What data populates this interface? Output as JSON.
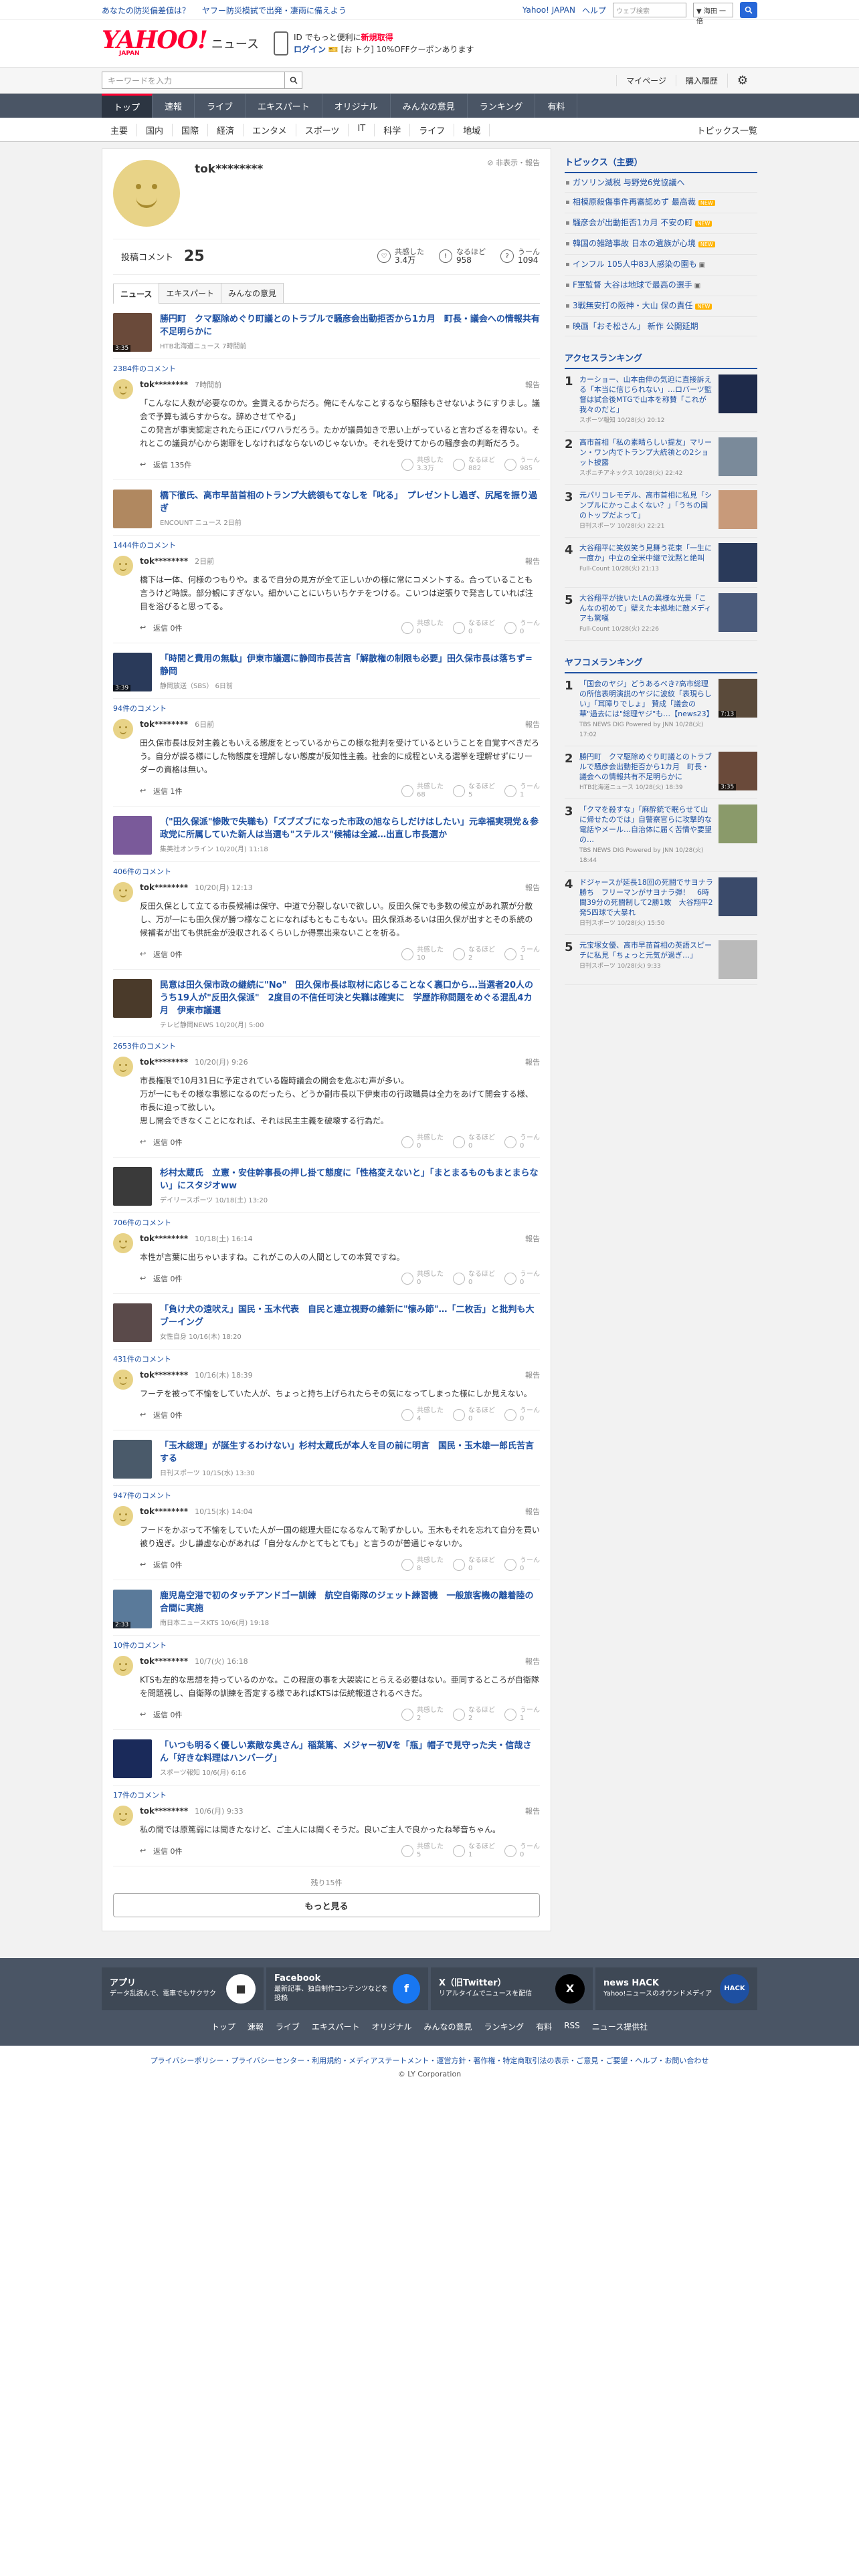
{
  "util": {
    "left1": "あなたの防災偏差値は？",
    "left2": "ヤフー防災模試で出発・凄雨に備えよう",
    "yj": "Yahoo! JAPAN",
    "help": "ヘルプ",
    "search_placeholder": "ウェブ検索",
    "search_select": "▼ 海田 一倍"
  },
  "header": {
    "logo": "YAHOO!",
    "logo_sub": "JAPAN",
    "logo_news": "ニュース",
    "promo_line1": "ID でもっと便利に",
    "promo_line1_red": "新規取得",
    "promo_login": "ログイン",
    "promo_line2": "[お トク] 10%OFFクーポンあります"
  },
  "search": {
    "placeholder": "キーワードを入力",
    "mypage": "マイページ",
    "history": "購入履歴"
  },
  "primary_nav": [
    "トップ",
    "速報",
    "ライブ",
    "エキスパート",
    "オリジナル",
    "みんなの意見",
    "ランキング",
    "有料"
  ],
  "secondary_nav": [
    "主要",
    "国内",
    "国際",
    "経済",
    "エンタメ",
    "スポーツ",
    "IT",
    "科学",
    "ライフ",
    "地域"
  ],
  "topics_list_link": "トピックス一覧",
  "profile": {
    "name": "tok********",
    "report": "非表示・報告",
    "comments_label": "投稿コメント",
    "comments_count": "25",
    "stat1_label": "共感した",
    "stat1_value": "3.4万",
    "stat2_label": "なるほど",
    "stat2_value": "958",
    "stat3_label": "うーん",
    "stat3_value": "1094",
    "tabs": [
      "ニュース",
      "エキスパート",
      "みんなの意見"
    ]
  },
  "items": [
    {
      "title": "勝円町　クマ駆除めぐり町議とのトラブルで騒彦会出動拒否から1カ月　町長・議会への情報共有不足明らかに",
      "src": "HTB北海道ニュース 7時間前",
      "dur": "3:35",
      "thumb": "#6a4a3a",
      "count": "2384件のコメント",
      "user": "tok********",
      "time": "7時間前",
      "text": "「こんなに人数が必要なのか。金貰えるからだろ。俺にそんなことするなら駆除もさせないようにすりまし。議会で予算も減らすからな。辞めさせてやる」\nこの発言が事実認定されたら正にパワハラだろう。たかが議員如きで思い上がっていると言わざるを得ない。それとこの議員が心から謝罪をしなければならないのじゃないか。それを受けてからの騒彦会の判断だろう。",
      "reply": "返信 135件",
      "r1": "共感した",
      "v1": "3.3万",
      "r2": "なるほど",
      "v2": "882",
      "r3": "うーん",
      "v3": "985"
    },
    {
      "title": "橋下徹氏、高市早苗首相のトランプ大統領もてなしを「叱る」　プレゼントし過ぎ、尻尾を振り過ぎ",
      "src": "ENCOUNT ニュース 2日前",
      "dur": "",
      "thumb": "#b08860",
      "count": "1444件のコメント",
      "user": "tok********",
      "time": "2日前",
      "text": "橋下は一体、何様のつもりや。まるで自分の見方が全て正しいかの様に常にコメントする。合っていることも言うけど時誤。部分観にすぎない。細かいことにいちいちケチをつける。こいつは逆張りで発言していれば注目を浴びると思ってる。",
      "reply": "返信 0件",
      "r1": "共感した",
      "v1": "0",
      "r2": "なるほど",
      "v2": "0",
      "r3": "うーん",
      "v3": "0"
    },
    {
      "title": "「時間と費用の無駄」伊東市議選に静岡市長苦言「解散権の制限も必要」田久保市長は落ちず=静岡",
      "src": "静岡放送（SBS） 6日前",
      "dur": "3:39",
      "thumb": "#2a3a5a",
      "count": "94件のコメント",
      "user": "tok********",
      "time": "6日前",
      "text": "田久保市長は反対主義ともいえる態度をとっているからこの様な批判を受けているということを自覚すべきだろう。自分が誤る様にした物態度を理解しない態度が反知性主義。社会的に成程といえる選挙を理解せずにリーダーの資格は無い。",
      "reply": "返信 1件",
      "r1": "共感した",
      "v1": "68",
      "r2": "なるほど",
      "v2": "5",
      "r3": "うーん",
      "v3": "1"
    },
    {
      "title": "（\"田久保派\"惨敗で失職も）「ズブズブになった市政の旭ならしだけはしたい」元幸福実現党＆参政党に所属していた新人は当選も\"ステルス\"候補は全滅…出直し市長選か",
      "src": "集英社オンライン 10/20(月) 11:18",
      "dur": "",
      "thumb": "#7a5a9a",
      "count": "406件のコメント",
      "user": "tok********",
      "time": "10/20(月) 12:13",
      "text": "反田久保として立てる市長候補は保守、中道で分裂しないで欲しい。反田久保でも多数の候立があれ票が分散し、万が一にも田久保が勝つ様なことになればもともこもない。田久保派あるいは田久保が出すとその系統の候補者が出ても供託金が没収されるくらいしか得票出来ないことを祈る。",
      "reply": "返信 0件",
      "r1": "共感した",
      "v1": "10",
      "r2": "なるほど",
      "v2": "2",
      "r3": "うーん",
      "v3": "1"
    },
    {
      "title": "民意は田久保市政の継続に\"No\"　田久保市長は取材に応じることなく裏口から…当選者20人のうち19人が\"反田久保派\"　2度目の不信任可決と失職は確実に　学歴詐称問題をめぐる混乱4カ月　伊東市議選",
      "src": "テレビ静岡NEWS 10/20(月) 5:00",
      "dur": "",
      "thumb": "#4a3a2a",
      "count": "2653件のコメント",
      "user": "tok********",
      "time": "10/20(月) 9:26",
      "text": "市長権限で10月31日に予定されている臨時議会の開会を危ぶむ声が多い。\n万が一にもその様な事態になるのだったら、どうか副市長以下伊東市の行政職員は全力をあげて開会する様、市長に迫って欲しい。\n思し開会できなくことになれば、それは民主主義を破壊する行為だ。",
      "reply": "返信 0件",
      "r1": "共感した",
      "v1": "0",
      "r2": "なるほど",
      "v2": "0",
      "r3": "うーん",
      "v3": "0"
    },
    {
      "title": "杉村太蔵氏　立憲・安住幹事長の押し掛て態度に「性格変えないと」「まとまるものもまとまらない」にスタジオww",
      "src": "デイリースポーツ 10/18(土) 13:20",
      "dur": "",
      "thumb": "#3a3a3a",
      "count": "706件のコメント",
      "user": "tok********",
      "time": "10/18(土) 16:14",
      "text": "本性が言葉に出ちゃいますね。これがこの人の人間としての本質ですね。",
      "reply": "返信 0件",
      "r1": "共感した",
      "v1": "0",
      "r2": "なるほど",
      "v2": "0",
      "r3": "うーん",
      "v3": "0"
    },
    {
      "title": "「負け犬の遠吠え」国民・玉木代表　自民と連立視野の維新に\"懐み節\"…「二枚舌」と批判も大ブーイング",
      "src": "女性自身 10/16(木) 18:20",
      "dur": "",
      "thumb": "#5a4a4a",
      "count": "431件のコメント",
      "user": "tok********",
      "time": "10/16(木) 18:39",
      "text": "フーテを被って不愉をしていた人が、ちょっと持ち上げられたらその気になってしまった様にしか見えない。",
      "reply": "返信 0件",
      "r1": "共感した",
      "v1": "4",
      "r2": "なるほど",
      "v2": "0",
      "r3": "うーん",
      "v3": "0"
    },
    {
      "title": "「玉木総理」が誕生するわけない」杉村太蔵氏が本人を目の前に明言　国民・玉木雄一郎氏苦言する",
      "src": "日刊スポーツ 10/15(水) 13:30",
      "dur": "",
      "thumb": "#4a5a6a",
      "count": "947件のコメント",
      "user": "tok********",
      "time": "10/15(水) 14:04",
      "text": "フードをかぶって不愉をしていた人が一国の総理大臣になるなんて恥ずかしい。玉木もそれを忘れて自分を買い被り過ぎ。少し謙虚な心があれば「自分なんかとてもとても」と言うのが普通じゃないか。",
      "reply": "返信 0件",
      "r1": "共感した",
      "v1": "8",
      "r2": "なるほど",
      "v2": "0",
      "r3": "うーん",
      "v3": "0"
    },
    {
      "title": "鹿児島空港で初のタッチアンドゴー訓練　航空自衛隊のジェット練習機　一般旅客機の離着陸の合間に実施",
      "src": "南日本ニュースKTS 10/6(月) 19:18",
      "dur": "2:33",
      "thumb": "#5a7a9a",
      "count": "10件のコメント",
      "user": "tok********",
      "time": "10/7(火) 16:18",
      "text": "KTSも左的な思想を持っているのかな。この程度の事を大袈裟にとらえる必要はない。亜同するところが自衛隊を問題視し、自衛隊の訓練を否定する様であればKTSは伝統報道されるべきだ。",
      "reply": "返信 0件",
      "r1": "共感した",
      "v1": "2",
      "r2": "なるほど",
      "v2": "2",
      "r3": "うーん",
      "v3": "1"
    },
    {
      "title": "「いつも明るく優しい素敵な奥さん」稲葉篤、メジャー初Vを「瓶」帽子で見守った夫・信哉さん「好きな料理はハンバーグ」",
      "src": "スポーツ報知 10/6(月) 6:16",
      "dur": "",
      "thumb": "#1a2a5a",
      "count": "17件のコメント",
      "user": "tok********",
      "time": "10/6(月) 9:33",
      "text": "私の間では原篤弱には聞きたなけど、ご主人には聞くそうだ。良いご主人で良かったね琴音ちゃん。",
      "reply": "返信 0件",
      "r1": "共感した",
      "v1": "5",
      "r2": "なるほど",
      "v2": "1",
      "r3": "うーん",
      "v3": "0"
    }
  ],
  "more": {
    "remaining": "残り15件",
    "button": "もっと見る"
  },
  "side": {
    "topics_title": "トピックス（主要）",
    "topics": [
      {
        "t": "ガソリン減税 与野党6党協議へ",
        "new": false,
        "cam": false
      },
      {
        "t": "相模原殺傷事件再審認めず 最高裁",
        "new": true,
        "cam": false
      },
      {
        "t": "騒彦会が出動拒否1カ月 不安の町",
        "new": true,
        "cam": false
      },
      {
        "t": "韓国の雑踏事故 日本の遺族が心境",
        "new": true,
        "cam": false
      },
      {
        "t": "インフル 105人中83人感染の園も",
        "new": false,
        "cam": true
      },
      {
        "t": "F軍監督 大谷は地球で最高の選手",
        "new": false,
        "cam": true
      },
      {
        "t": "3戦無安打の阪神・大山 保の責任",
        "new": true,
        "cam": false
      },
      {
        "t": "映画「おそ松さん」 新作 公開延期",
        "new": false,
        "cam": false
      }
    ],
    "access_title": "アクセスランキング",
    "access": [
      {
        "n": "1",
        "t": "カーショー、山本由伸の気迫に直接訴える「本当に信じられない」…ロバーツ監督は試合後MTGで山本を称賛「これが我々のだと」",
        "s": "スポーツ報知 10/28(火) 20:12",
        "c": "#1e2a4a"
      },
      {
        "n": "2",
        "t": "高市首相「私の素晴らしい提友」マリーン・ワン内でトランプ大統領との2ショット披露",
        "s": "スポニチアネックス 10/28(火) 22:42",
        "c": "#7a8a9a"
      },
      {
        "n": "3",
        "t": "元パリコレモデル、高市首相に私見「シンプルにかっこよくない？」「うちの国のトップだよって」",
        "s": "日刊スポーツ 10/28(火) 22:21",
        "c": "#c89a7a"
      },
      {
        "n": "4",
        "t": "大谷翔平に笑奴笑う見舞う花束「一生に一度か」中立の全米中継で沈黙と絶叫",
        "s": "Full-Count 10/28(火) 21:13",
        "c": "#2a3a5a"
      },
      {
        "n": "5",
        "t": "大谷翔平が抜いたLAの異様な光景「こんなの初めて」壁えた本拠地に敵メディアも驚嘆",
        "s": "Full-Count 10/28(火) 22:26",
        "c": "#4a5a7a"
      }
    ],
    "yafoo_title": "ヤフコメランキング",
    "yafoo": [
      {
        "n": "1",
        "t": "「国会のヤジ」どうあるべき?高市総理の所信表明演説のヤジに波紋「表現らしい」「耳障りでしょ」 賛成「議会の華\"過去には\"総理ヤジ\"も…【news23】",
        "s": "TBS NEWS DIG Powered by JNN 10/28(火) 17:02",
        "c": "#5a4a3a",
        "dur": "7:13"
      },
      {
        "n": "2",
        "t": "勝円町　クマ駆除めぐり町議とのトラブルで騒彦会出動拒否から1カ月　町長・議会への情報共有不足明らかに",
        "s": "HTB北海道ニュース 10/28(火) 18:39",
        "c": "#6a4a3a",
        "dur": "3:35"
      },
      {
        "n": "3",
        "t": "「クマを殺すな」「麻酔銃で眠らせて山に帰せたのでは」自警察官らに攻撃的な電話やメール…自治体に届く苦情や要望の…",
        "s": "TBS NEWS DIG Powered by JNN 10/28(火) 18:44",
        "c": "#8a9a6a",
        "dur": ""
      },
      {
        "n": "4",
        "t": "ドジャースが延長18回の死闘でサヨナラ勝ち　フリーマンがサヨナラ弾！　6時間39分の死闘制して2勝1敗　大谷翔平2発5四球で大暴れ",
        "s": "日刊スポーツ 10/28(火) 15:50",
        "c": "#3a4a6a",
        "dur": ""
      },
      {
        "n": "5",
        "t": "元宝塚女優、高市早苗首相の英語スピーチに私見「ちょっと元気が過ぎ…」",
        "s": "日刊スポーツ 10/28(火) 9:33",
        "c": "#bababa",
        "dur": ""
      }
    ]
  },
  "footer": {
    "apps": [
      {
        "title": "アプリ",
        "desc": "データ乱読んで、電車でもサクサク",
        "icon": "■",
        "bg": "#ffffff",
        "fg": "#333"
      },
      {
        "title": "Facebook",
        "desc": "最新記事、独自制作コンテンツなどを投稿",
        "icon": "f",
        "bg": "#1877f2",
        "fg": "#fff"
      },
      {
        "title": "X（旧Twitter）",
        "desc": "リアルタイムでニュースを配信",
        "icon": "X",
        "bg": "#000000",
        "fg": "#fff"
      },
      {
        "title": "news HACK",
        "desc": "Yahoo!ニュースのオウンドメディア",
        "icon": "HACK",
        "bg": "#1e50a2",
        "fg": "#fff"
      }
    ],
    "nav": [
      "トップ",
      "速報",
      "ライブ",
      "エキスパート",
      "オリジナル",
      "みんなの意見",
      "ランキング",
      "有料",
      "RSS",
      "ニュース提供社"
    ],
    "legal": "プライバシーポリシー・プライバシーセンター・利用規約・メディアステートメント・運営方針・著作権・特定商取引法の表示・ご意見・ご要望・ヘルプ・お問い合わせ",
    "copy": "© LY Corporation"
  }
}
